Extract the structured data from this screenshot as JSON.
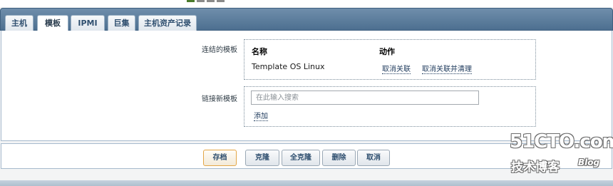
{
  "tabs": [
    {
      "label": "主机",
      "active": false
    },
    {
      "label": "模板",
      "active": true
    },
    {
      "label": "IPMI",
      "active": false
    },
    {
      "label": "巨集",
      "active": false
    },
    {
      "label": "主机资产记录",
      "active": false
    }
  ],
  "linked_templates": {
    "label": "连结的模板",
    "col_name": "名称",
    "col_action": "动作",
    "rows": [
      {
        "name": "Template OS Linux",
        "unlink": "取消关联",
        "unlink_clear": "取消关联并清理"
      }
    ]
  },
  "new_templates": {
    "label": "链接新模板",
    "search_placeholder": "在此输入搜索",
    "add_link": "添加"
  },
  "buttons": {
    "save": "存档",
    "clone": "克隆",
    "full_clone": "全克隆",
    "delete": "删除",
    "cancel": "取消"
  },
  "watermark": {
    "logo": "51CTO.com",
    "sub": "技术博客",
    "blog": "Blog"
  }
}
